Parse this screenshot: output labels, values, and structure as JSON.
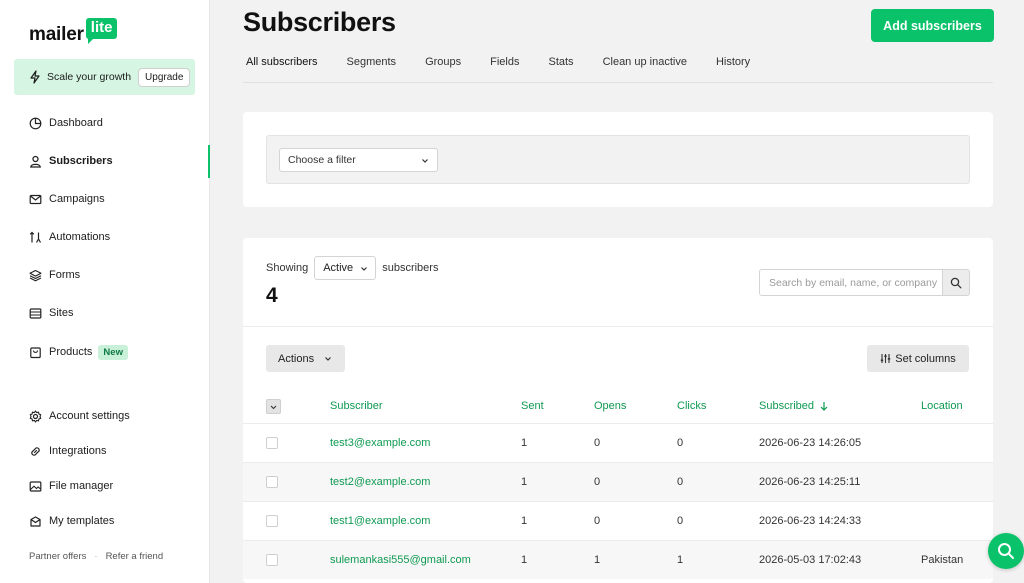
{
  "brand": {
    "name_left": "mailer",
    "name_right": "lite",
    "accent": "#09c269"
  },
  "upgrade": {
    "text": "Scale your growth",
    "button": "Upgrade"
  },
  "sidebar": {
    "items": [
      {
        "label": "Dashboard",
        "icon": "dashboard-icon"
      },
      {
        "label": "Subscribers",
        "icon": "user-icon",
        "active": true
      },
      {
        "label": "Campaigns",
        "icon": "mail-icon"
      },
      {
        "label": "Automations",
        "icon": "automation-icon"
      },
      {
        "label": "Forms",
        "icon": "layers-icon"
      },
      {
        "label": "Sites",
        "icon": "sites-icon"
      },
      {
        "label": "Products",
        "icon": "product-icon",
        "badge": "New"
      }
    ],
    "bottom_items": [
      {
        "label": "Account settings",
        "icon": "gear-icon"
      },
      {
        "label": "Integrations",
        "icon": "link-icon"
      },
      {
        "label": "File manager",
        "icon": "image-icon"
      },
      {
        "label": "My templates",
        "icon": "template-icon"
      }
    ],
    "footer": {
      "partner": "Partner offers",
      "refer": "Refer a friend"
    }
  },
  "header": {
    "title": "Subscribers",
    "add_button": "Add subscribers"
  },
  "tabs": [
    "All subscribers",
    "Segments",
    "Groups",
    "Fields",
    "Stats",
    "Clean up inactive",
    "History"
  ],
  "filter": {
    "placeholder": "Choose a filter"
  },
  "list": {
    "showing_label": "Showing",
    "status_value": "Active",
    "subscribers_label": "subscribers",
    "count": "4",
    "search_placeholder": "Search by email, name, or company",
    "actions_label": "Actions",
    "set_columns_label": "Set columns",
    "columns": [
      "Subscriber",
      "Sent",
      "Opens",
      "Clicks",
      "Subscribed",
      "Location"
    ],
    "sort_column": "Subscribed",
    "rows": [
      {
        "email": "test3@example.com",
        "sent": "1",
        "opens": "0",
        "clicks": "0",
        "subscribed": "2026-06-23 14:26:05",
        "location": ""
      },
      {
        "email": "test2@example.com",
        "sent": "1",
        "opens": "0",
        "clicks": "0",
        "subscribed": "2026-06-23 14:25:11",
        "location": ""
      },
      {
        "email": "test1@example.com",
        "sent": "1",
        "opens": "0",
        "clicks": "0",
        "subscribed": "2026-06-23 14:24:33",
        "location": ""
      },
      {
        "email": "sulemankasi555@gmail.com",
        "sent": "1",
        "opens": "1",
        "clicks": "1",
        "subscribed": "2026-05-03 17:02:43",
        "location": "Pakistan"
      }
    ]
  }
}
